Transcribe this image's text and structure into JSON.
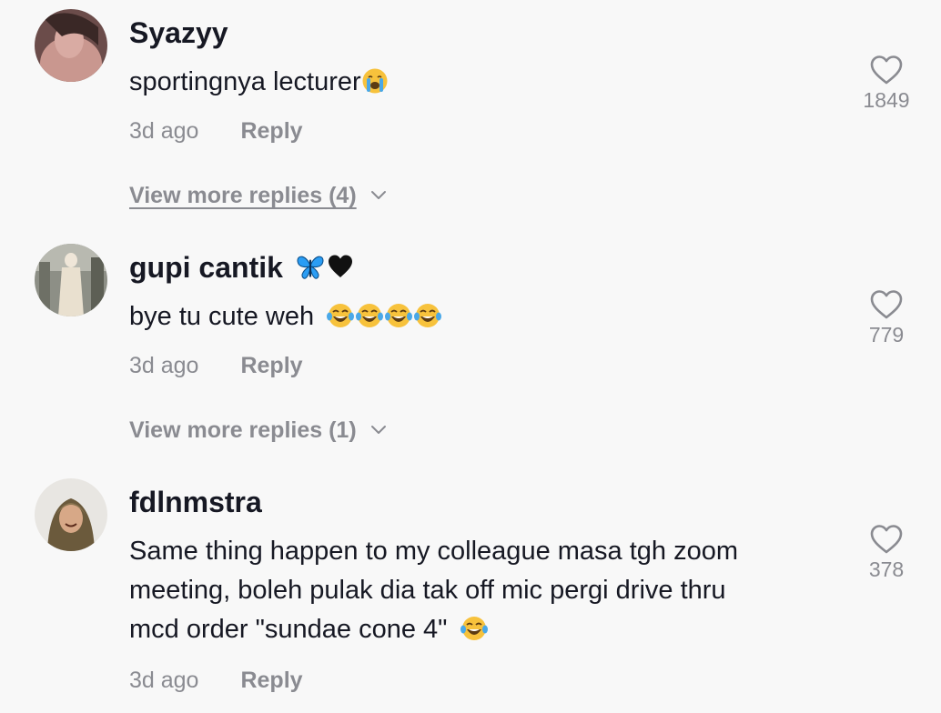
{
  "comments": [
    {
      "username": "Syazyy",
      "text": "sportingnya lecturer",
      "text_emoji": "crying-face",
      "time": "3d ago",
      "reply_label": "Reply",
      "likes": "1849",
      "view_more": "View more replies (4)"
    },
    {
      "username": "gupi cantik",
      "username_emojis": [
        "butterfly",
        "black-heart"
      ],
      "text": "bye tu cute weh",
      "text_emojis": [
        "tears-of-joy",
        "tears-of-joy",
        "tears-of-joy",
        "tears-of-joy"
      ],
      "time": "3d ago",
      "reply_label": "Reply",
      "likes": "779",
      "view_more": "View more replies (1)"
    },
    {
      "username": "fdlnmstra",
      "text_lines": [
        "Same thing happen to my colleague masa tgh zoom",
        "meeting, boleh pulak dia tak off mic pergi drive thru",
        "mcd order \"sundae cone 4\""
      ],
      "text_emoji": "tears-of-joy",
      "time": "3d ago",
      "reply_label": "Reply",
      "likes": "378"
    }
  ],
  "colors": {
    "background": "#f8f8f8",
    "primary_text": "#161823",
    "secondary_text": "#8a8b91",
    "emoji_yellow": "#f7c23c",
    "emoji_tear": "#4aa8e8",
    "butterfly_blue": "#2a9df4"
  }
}
